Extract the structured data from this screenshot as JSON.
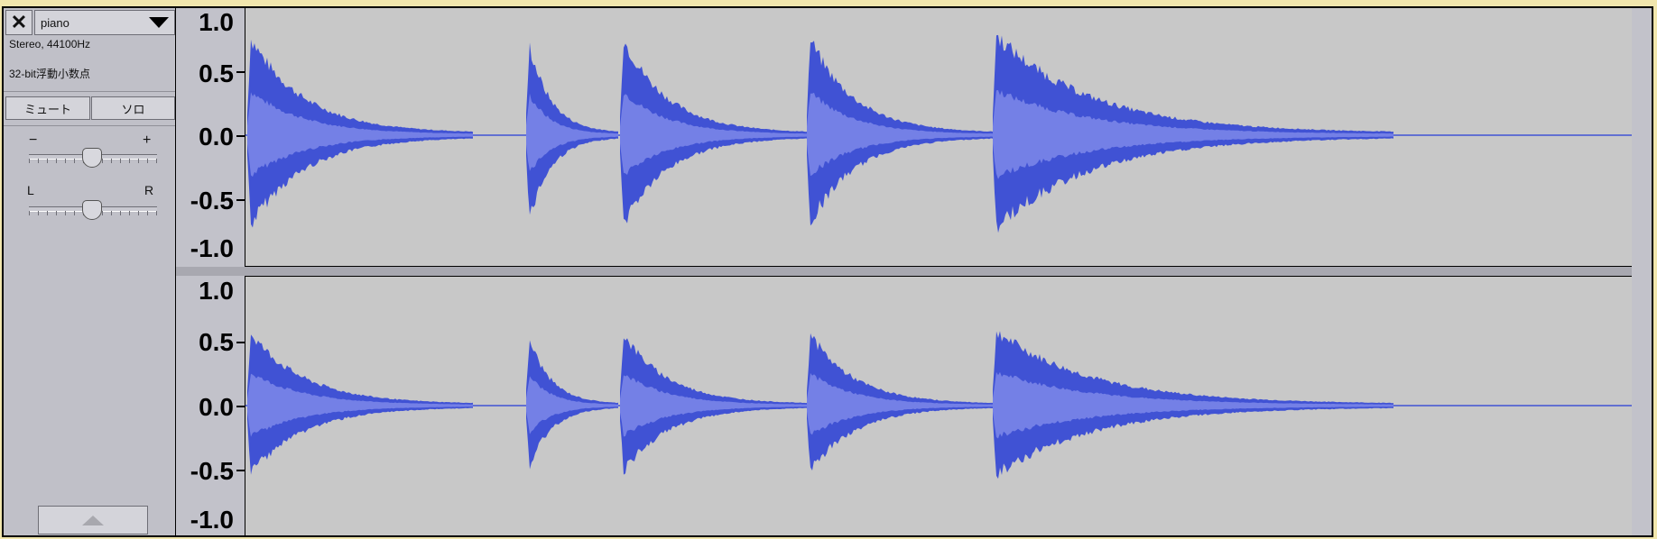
{
  "track": {
    "close_icon": "✕",
    "name": "piano",
    "dropdown_icon": "chevron-down",
    "format": "Stereo, 44100Hz",
    "sample_format": "32-bit浮動小数点",
    "mute_label": "ミュート",
    "solo_label": "ソロ",
    "gain_minus": "−",
    "gain_plus": "+",
    "pan_left": "L",
    "pan_right": "R",
    "collapse_icon": "collapse-up-arrow"
  },
  "ruler": {
    "labels": [
      "1.0",
      "0.5",
      "0.0",
      "-0.5",
      "-1.0"
    ]
  },
  "colors": {
    "waveform_outer": "#4052d4",
    "waveform_rms": "#7480e6",
    "background": "#c8c8c8"
  }
}
